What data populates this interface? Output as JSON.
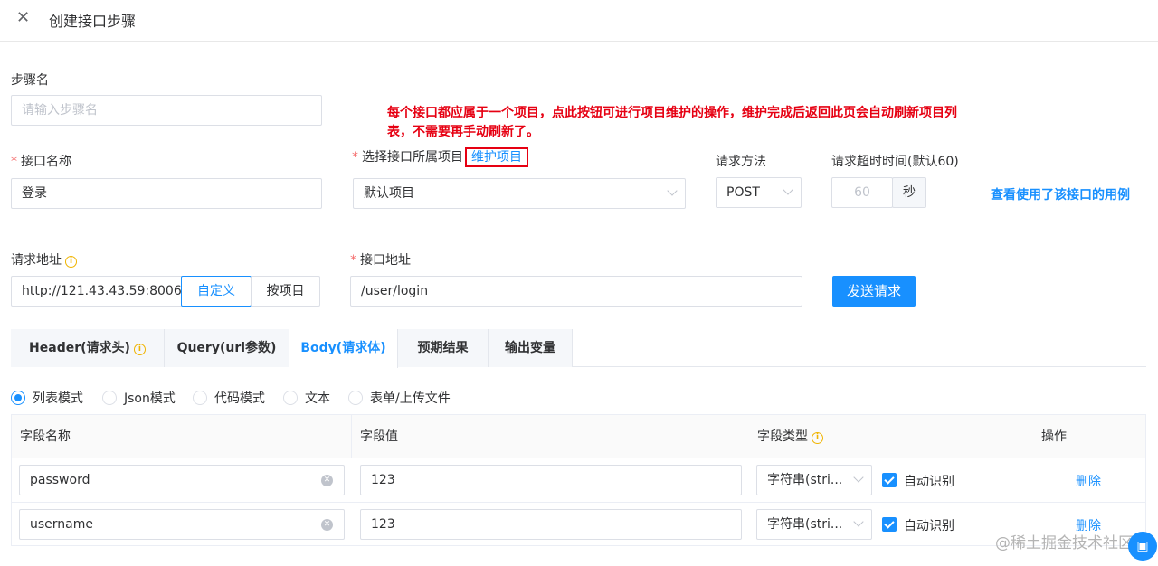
{
  "header": {
    "close_icon": "close-icon",
    "title": "创建接口步骤"
  },
  "step_name": {
    "label": "步骤名",
    "placeholder": "请输入步骤名"
  },
  "annotation": {
    "line1": "每个接口都应属于一个项目，点此按钮可进行项目维护的操作，维护完成后返回此页会自动刷新项目列",
    "line2": "表，不需要再手动刷新了。"
  },
  "interface_name": {
    "required": "*",
    "label": "接口名称",
    "value": "登录"
  },
  "project": {
    "required": "*",
    "label": "选择接口所属项目",
    "maintain_link": "维护项目",
    "value": "默认项目"
  },
  "method": {
    "label": "请求方法",
    "value": "POST"
  },
  "timeout": {
    "label": "请求超时时间(默认60)",
    "placeholder": "60",
    "unit": "秒"
  },
  "view_usage_link": "查看使用了该接口的用例",
  "request_url": {
    "label": "请求地址",
    "value": "http://121.43.43.59:8006",
    "custom_button": "自定义",
    "by_project_button": "按项目"
  },
  "api_path": {
    "required": "*",
    "label": "接口地址",
    "value": "/user/login"
  },
  "send_button": "发送请求",
  "tabs": [
    "Header(请求头)",
    "Query(url参数)",
    "Body(请求体)",
    "预期结果",
    "输出变量"
  ],
  "active_tab": "Body(请求体)",
  "body_modes": [
    "列表模式",
    "Json模式",
    "代码模式",
    "文本",
    "表单/上传文件"
  ],
  "selected_mode": "列表模式",
  "table": {
    "headers": [
      "字段名称",
      "字段值",
      "字段类型",
      "操作"
    ],
    "rows": [
      {
        "name": "password",
        "value": "123",
        "type": "字符串(stri...",
        "auto": "自动识别",
        "action": "删除"
      },
      {
        "name": "username",
        "value": "123",
        "type": "字符串(stri...",
        "auto": "自动识别",
        "action": "删除"
      }
    ]
  },
  "watermark": "@稀土掘金技术社区",
  "colors": {
    "primary": "#1890ff",
    "required": "#f56c6c",
    "annotation": "#e60012",
    "warning": "#f0b400"
  }
}
